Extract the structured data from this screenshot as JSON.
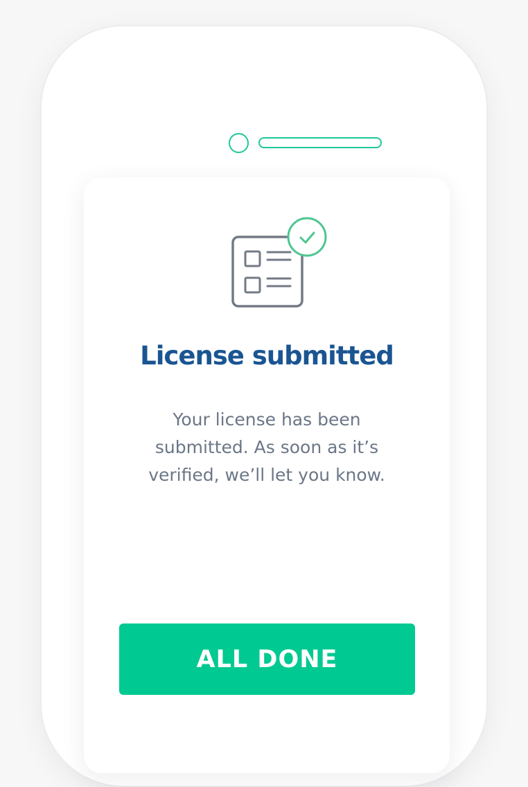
{
  "colors": {
    "accent": "#00c991",
    "accent_outline": "#1fc79a",
    "title": "#1a5592",
    "body_text": "#6b7686",
    "icon_stroke": "#737a85"
  },
  "device": {
    "camera_icon": "camera-circle",
    "speaker_icon": "speaker-slot"
  },
  "card": {
    "icon": "checklist-check-icon",
    "title": "License submitted",
    "message": "Your license has been submitted. As soon as it’s verified, we’ll let you know.",
    "button_label": "ALL DONE"
  }
}
